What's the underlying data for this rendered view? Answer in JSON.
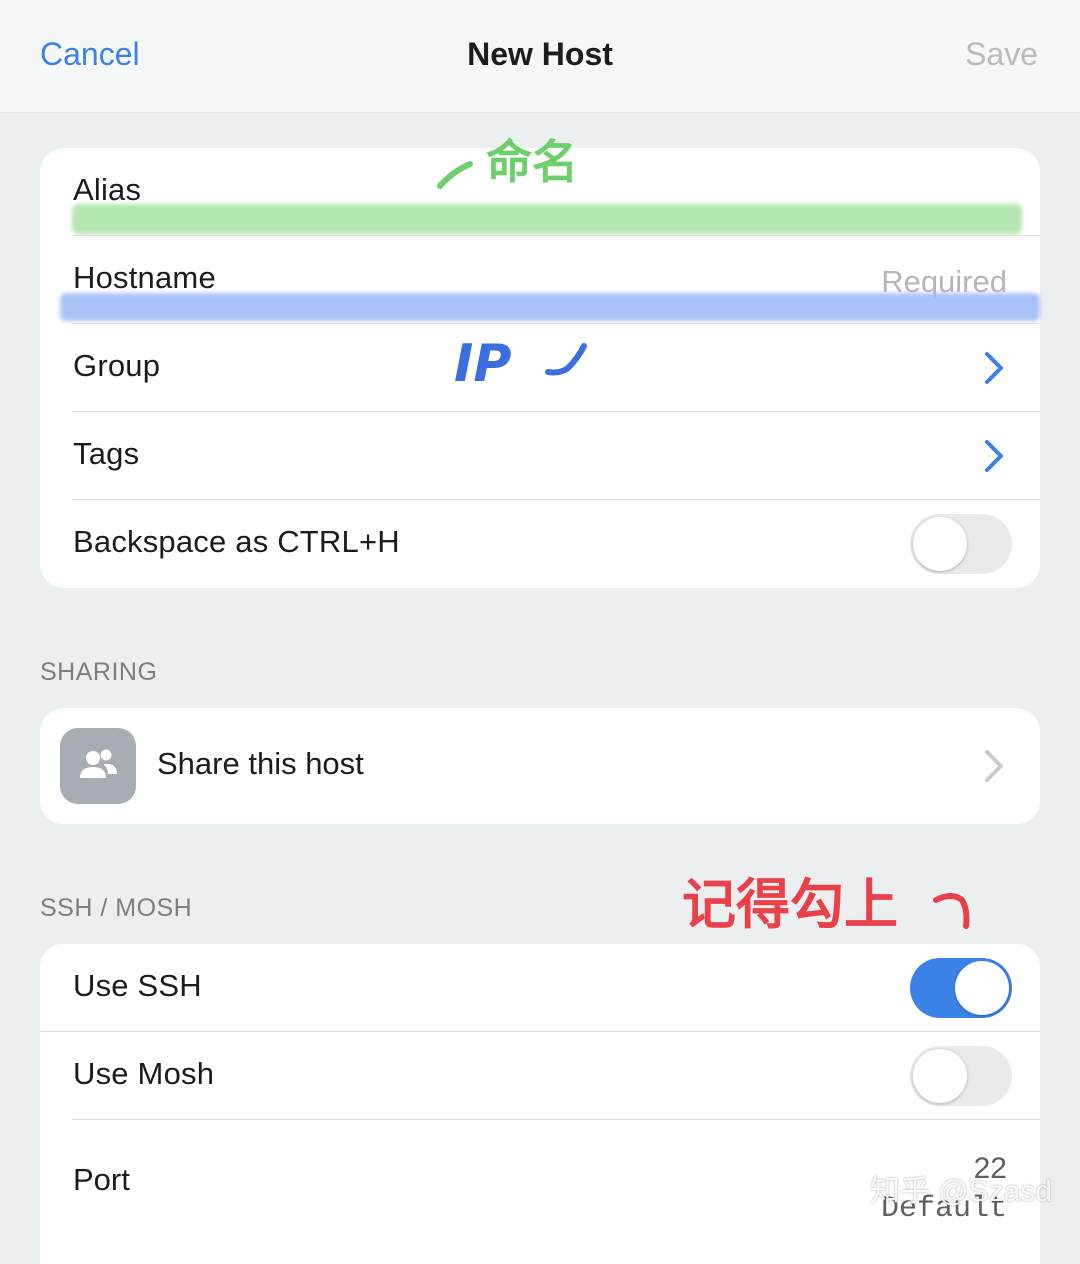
{
  "navbar": {
    "cancel": "Cancel",
    "title": "New Host",
    "save": "Save"
  },
  "host_section": {
    "rows": [
      {
        "label": "Alias"
      },
      {
        "label": "Hostname",
        "placeholder": "Required"
      },
      {
        "label": "Group"
      },
      {
        "label": "Tags"
      },
      {
        "label": "Backspace as CTRL+H",
        "toggle_on": false
      }
    ]
  },
  "sharing_section": {
    "header": "SHARING",
    "share_label": "Share this host"
  },
  "ssh_section": {
    "header": "SSH / MOSH",
    "use_ssh": {
      "label": "Use SSH",
      "toggle_on": true
    },
    "use_mosh": {
      "label": "Use Mosh",
      "toggle_on": false
    },
    "port": {
      "label": "Port",
      "value": "22",
      "hint": "Default"
    }
  },
  "annotations": {
    "alias_note": "命名",
    "hostname_note": "IP",
    "ssh_note": "记得勾上"
  },
  "watermark": "知乎 @Szasd",
  "colors": {
    "accent": "#3b82e8",
    "alias_highlight": "#a8e2a4",
    "hostname_highlight": "#9db8f5",
    "note_green": "#6ccf6a",
    "note_blue": "#3b6fe0",
    "note_red": "#e8414a"
  }
}
